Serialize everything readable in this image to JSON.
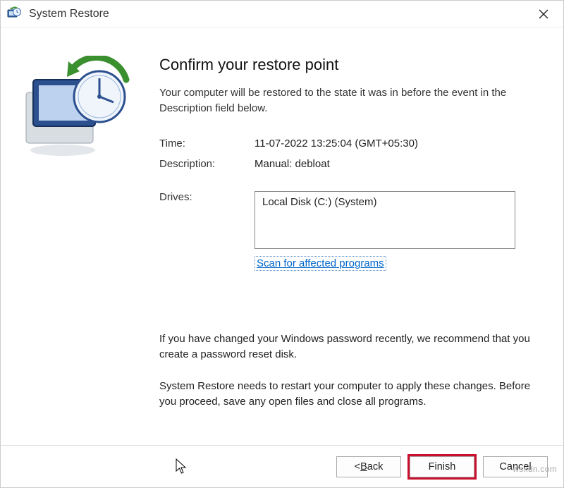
{
  "window": {
    "title": "System Restore"
  },
  "heading": "Confirm your restore point",
  "lead": "Your computer will be restored to the state it was in before the event in the Description field below.",
  "info": {
    "time_label": "Time:",
    "time_value": "11-07-2022 13:25:04 (GMT+05:30)",
    "description_label": "Description:",
    "description_value": "Manual: debloat",
    "drives_label": "Drives:",
    "drives_value": "Local Disk (C:) (System)"
  },
  "scan_link": "Scan for affected programs",
  "notice1": "If you have changed your Windows password recently, we recommend that you create a password reset disk.",
  "notice2": "System Restore needs to restart your computer to apply these changes. Before you proceed, save any open files and close all programs.",
  "buttons": {
    "back_prefix": "< ",
    "back_u": "B",
    "back_suffix": "ack",
    "finish": "Finish",
    "cancel": "Cancel"
  },
  "watermark": "wsxdn.com"
}
